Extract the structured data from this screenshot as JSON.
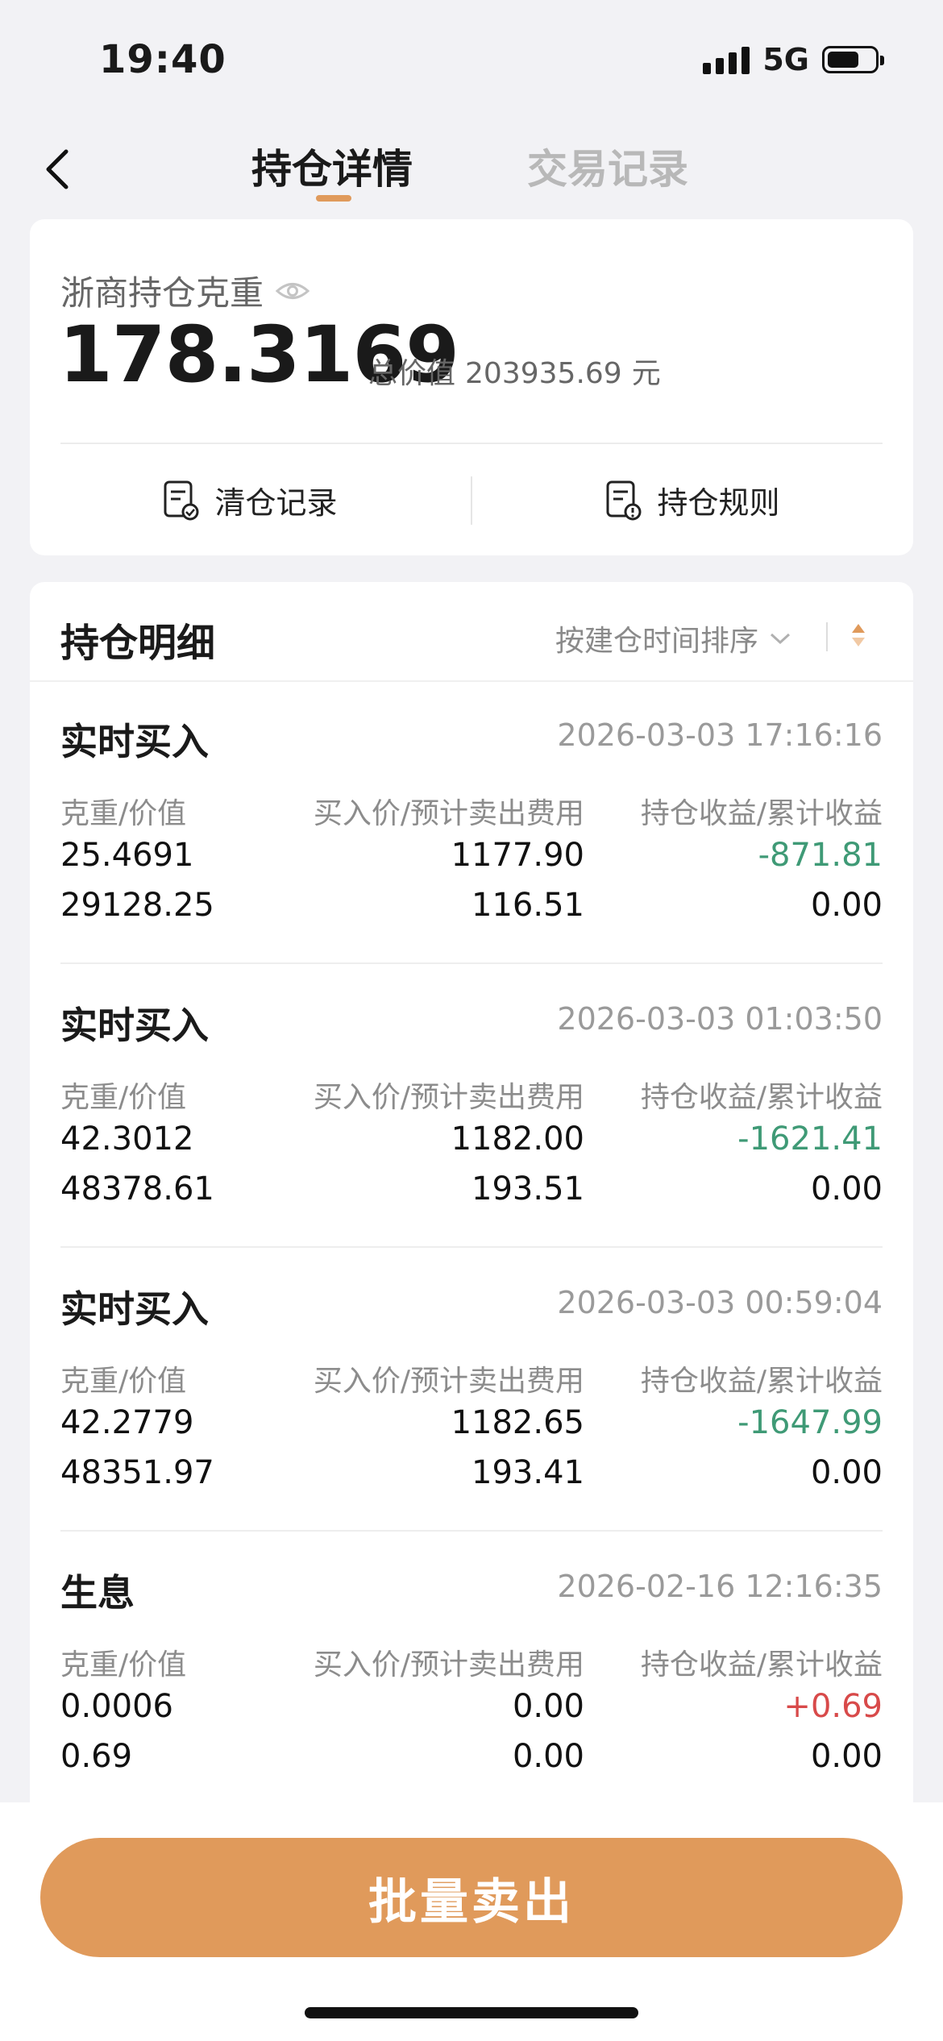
{
  "status": {
    "time": "19:40",
    "network": "5G"
  },
  "nav": {
    "tabs": [
      {
        "label": "持仓详情"
      },
      {
        "label": "交易记录"
      }
    ]
  },
  "summary": {
    "title": "浙商持仓克重",
    "weight": "178.3169",
    "total_label": "总价值",
    "total_value": "203935.69",
    "total_unit": "元",
    "actions": [
      {
        "label": "清仓记录",
        "icon": "clear-record-icon"
      },
      {
        "label": "持仓规则",
        "icon": "rules-icon"
      }
    ]
  },
  "detail": {
    "title": "持仓明细",
    "sort_label": "按建仓时间排序",
    "records": [
      {
        "type": "实时买入",
        "time": "2026-03-03 17:16:16",
        "headers": [
          "克重/价值",
          "买入价/预计卖出费用",
          "持仓收益/累计收益"
        ],
        "weight": "25.4691",
        "value": "29128.25",
        "buy_price": "1177.90",
        "sell_fee": "116.51",
        "holding_gain": "-871.81",
        "total_gain": "0.00"
      },
      {
        "type": "实时买入",
        "time": "2026-03-03 01:03:50",
        "headers": [
          "克重/价值",
          "买入价/预计卖出费用",
          "持仓收益/累计收益"
        ],
        "weight": "42.3012",
        "value": "48378.61",
        "buy_price": "1182.00",
        "sell_fee": "193.51",
        "holding_gain": "-1621.41",
        "total_gain": "0.00"
      },
      {
        "type": "实时买入",
        "time": "2026-03-03 00:59:04",
        "headers": [
          "克重/价值",
          "买入价/预计卖出费用",
          "持仓收益/累计收益"
        ],
        "weight": "42.2779",
        "value": "48351.97",
        "buy_price": "1182.65",
        "sell_fee": "193.41",
        "holding_gain": "-1647.99",
        "total_gain": "0.00"
      },
      {
        "type": "生息",
        "time": "2026-02-16 12:16:35",
        "headers": [
          "克重/价值",
          "买入价/预计卖出费用",
          "持仓收益/累计收益"
        ],
        "weight": "0.0006",
        "value": "0.69",
        "buy_price": "0.00",
        "sell_fee": "0.00",
        "holding_gain": "+0.69",
        "total_gain": "0.00"
      }
    ]
  },
  "bottom": {
    "sell_label": "批量卖出"
  },
  "colors": {
    "accent": "#e09a5b",
    "loss": "#3f9a76",
    "gain": "#d84a4a"
  }
}
